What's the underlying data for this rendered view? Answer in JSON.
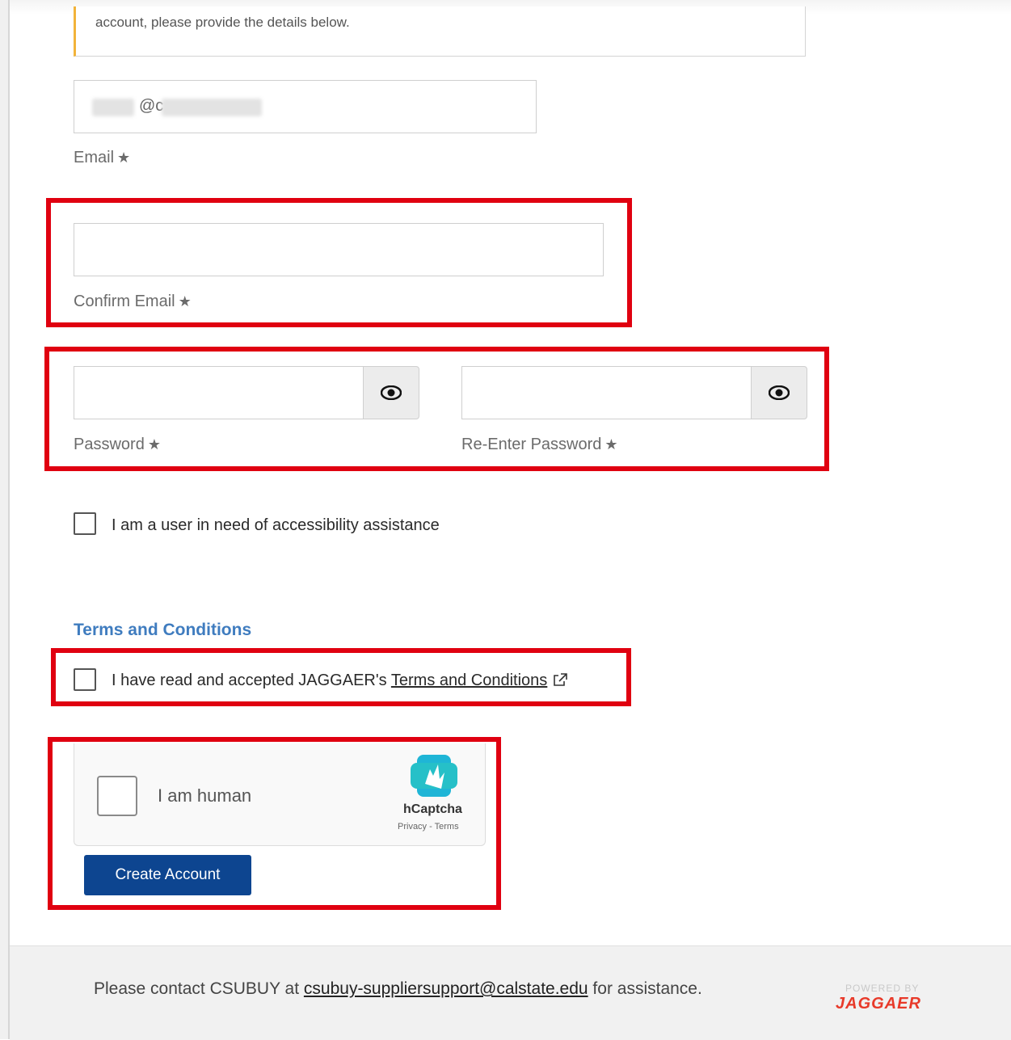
{
  "notice": {
    "text": "account, please provide the details below."
  },
  "email": {
    "value_visible": "@c",
    "label": "Email"
  },
  "confirm_email": {
    "label": "Confirm Email"
  },
  "password": {
    "label": "Password"
  },
  "re_password": {
    "label": "Re-Enter Password"
  },
  "accessibility": {
    "label": "I am a user in need of accessibility assistance"
  },
  "terms": {
    "section_title": "Terms and Conditions",
    "prefix": "I have read and accepted JAGGAER's ",
    "link_text": "Terms and Conditions"
  },
  "captcha": {
    "label": "I am human",
    "brand": "hCaptcha",
    "links": "Privacy - Terms"
  },
  "create_button": {
    "label": "Create Account"
  },
  "footer": {
    "prefix": "Please contact CSUBUY at ",
    "email_link": "csubuy-suppliersupport@calstate.edu",
    "suffix": " for assistance.",
    "powered_by": "POWERED BY",
    "brand": "JAGGAER"
  },
  "colors": {
    "highlight_red": "#e00010",
    "primary_button": "#0d4590",
    "section_title": "#3f7cbf",
    "notice_accent": "#f2b33a"
  }
}
